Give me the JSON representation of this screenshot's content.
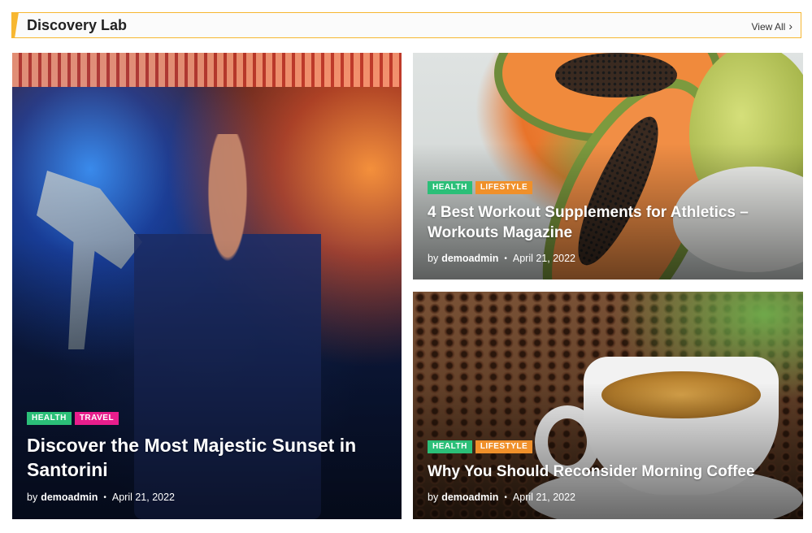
{
  "section": {
    "title": "Discovery Lab",
    "view_all": "View All"
  },
  "accent_color": "#f7b731",
  "articles": [
    {
      "categories": [
        {
          "label": "HEALTH",
          "color": "#2bbf78"
        },
        {
          "label": "TRAVEL",
          "color": "#e81e8c"
        }
      ],
      "title": "Discover the Most Majestic Sunset in Santorini",
      "by": "by",
      "author": "demoadmin",
      "date": "April 21, 2022"
    },
    {
      "categories": [
        {
          "label": "HEALTH",
          "color": "#2bbf78"
        },
        {
          "label": "LIFESTYLE",
          "color": "#f0902a"
        }
      ],
      "title": "4 Best Workout Supplements for Athletics – Workouts Magazine",
      "by": "by",
      "author": "demoadmin",
      "date": "April 21, 2022"
    },
    {
      "categories": [
        {
          "label": "HEALTH",
          "color": "#2bbf78"
        },
        {
          "label": "LIFESTYLE",
          "color": "#f0902a"
        }
      ],
      "title": "Why You Should Reconsider Morning Coffee",
      "by": "by",
      "author": "demoadmin",
      "date": "April 21, 2022"
    }
  ]
}
